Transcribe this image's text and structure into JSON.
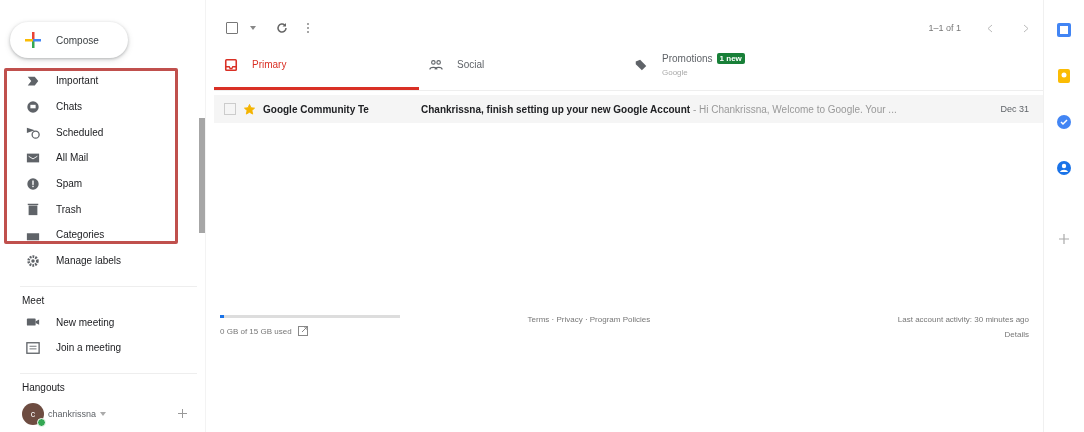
{
  "compose": {
    "label": "Compose"
  },
  "nav_items": [
    {
      "label": "Important",
      "kind": "important"
    },
    {
      "label": "Chats",
      "kind": "chats"
    },
    {
      "label": "Scheduled",
      "kind": "scheduled"
    },
    {
      "label": "All Mail",
      "kind": "allmail"
    },
    {
      "label": "Spam",
      "kind": "spam"
    },
    {
      "label": "Trash",
      "kind": "trash"
    },
    {
      "label": "Categories",
      "kind": "categories"
    },
    {
      "label": "Manage labels",
      "kind": "gear"
    }
  ],
  "meet": {
    "title": "Meet",
    "items": [
      {
        "label": "New meeting",
        "kind": "video"
      },
      {
        "label": "Join a meeting",
        "kind": "keyboard"
      }
    ]
  },
  "hangouts": {
    "title": "Hangouts",
    "user": {
      "initial": "c",
      "name": "chankrissna",
      "online": true
    }
  },
  "toolbar": {
    "select_all_checked": false,
    "pagination": "1–1 of 1"
  },
  "tabs": [
    {
      "label": "Primary",
      "kind": "inbox",
      "selected": true
    },
    {
      "label": "Social",
      "kind": "people",
      "selected": false
    },
    {
      "label": "Promotions",
      "kind": "tag",
      "selected": false,
      "badge": "1 new",
      "subtitle": "Google"
    }
  ],
  "emails": [
    {
      "sender": "Google Community Te",
      "subject": "Chankrissna, finish setting up your new Google Account",
      "snippet": " - Hi Chankrissna, Welcome to Google. Your ...",
      "date": "Dec 31",
      "starred": true,
      "checked": false
    }
  ],
  "footer": {
    "storage": {
      "text": "0 GB of 15 GB used",
      "level": 0.02
    },
    "links": "Terms · Privacy · Program Policies",
    "activity": "Last account activity: 30 minutes ago",
    "details": "Details"
  }
}
